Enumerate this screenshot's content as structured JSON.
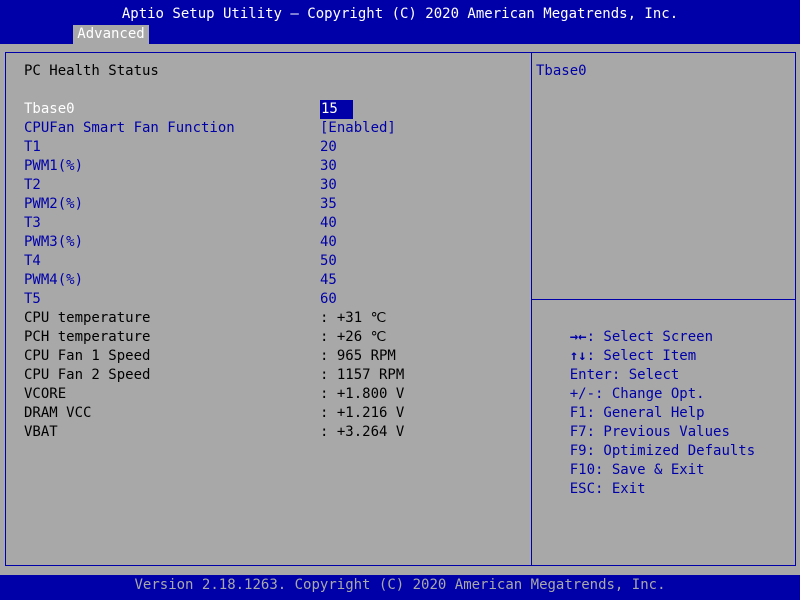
{
  "header": {
    "title": "Aptio Setup Utility – Copyright (C) 2020 American Megatrends, Inc.",
    "active_tab": "Advanced"
  },
  "main": {
    "section_title": "PC Health Status",
    "items": [
      {
        "label": "Tbase0",
        "value": "15"
      },
      {
        "label": "CPUFan Smart Fan Function",
        "value": "[Enabled]"
      },
      {
        "label": "T1",
        "value": "20"
      },
      {
        "label": "PWM1(%)",
        "value": "30"
      },
      {
        "label": "T2",
        "value": "30"
      },
      {
        "label": "PWM2(%)",
        "value": "35"
      },
      {
        "label": "T3",
        "value": "40"
      },
      {
        "label": "PWM3(%)",
        "value": "40"
      },
      {
        "label": "T4",
        "value": "50"
      },
      {
        "label": "PWM4(%)",
        "value": "45"
      },
      {
        "label": "T5",
        "value": "60"
      },
      {
        "label": "CPU temperature",
        "value": ": +31 ℃"
      },
      {
        "label": "PCH temperature",
        "value": ": +26 ℃"
      },
      {
        "label": "CPU Fan 1 Speed",
        "value": ": 965 RPM"
      },
      {
        "label": "CPU Fan 2 Speed",
        "value": ": 1157 RPM"
      },
      {
        "label": "VCORE",
        "value": ": +1.800 V"
      },
      {
        "label": "DRAM VCC",
        "value": ": +1.216 V"
      },
      {
        "label": "VBAT",
        "value": ": +3.264 V"
      }
    ]
  },
  "help_panel": {
    "title": "Tbase0",
    "keys": [
      {
        "key": "→←",
        "desc": ": Select Screen"
      },
      {
        "key": "↑↓",
        "desc": ": Select Item"
      },
      {
        "key": "Enter",
        "desc": ": Select"
      },
      {
        "key": "+/-",
        "desc": ": Change Opt."
      },
      {
        "key": "F1",
        "desc": ": General Help"
      },
      {
        "key": "F7",
        "desc": ": Previous Values"
      },
      {
        "key": "F9",
        "desc": ": Optimized Defaults"
      },
      {
        "key": "F10",
        "desc": ": Save & Exit"
      },
      {
        "key": "ESC",
        "desc": ": Exit"
      }
    ]
  },
  "footer": {
    "version": "Version 2.18.1263. Copyright (C) 2020 American Megatrends, Inc."
  },
  "colors": {
    "background": "#a8a8a8",
    "accent": "#0000a8",
    "highlight_text": "#ffffff",
    "static_text": "#000000"
  }
}
